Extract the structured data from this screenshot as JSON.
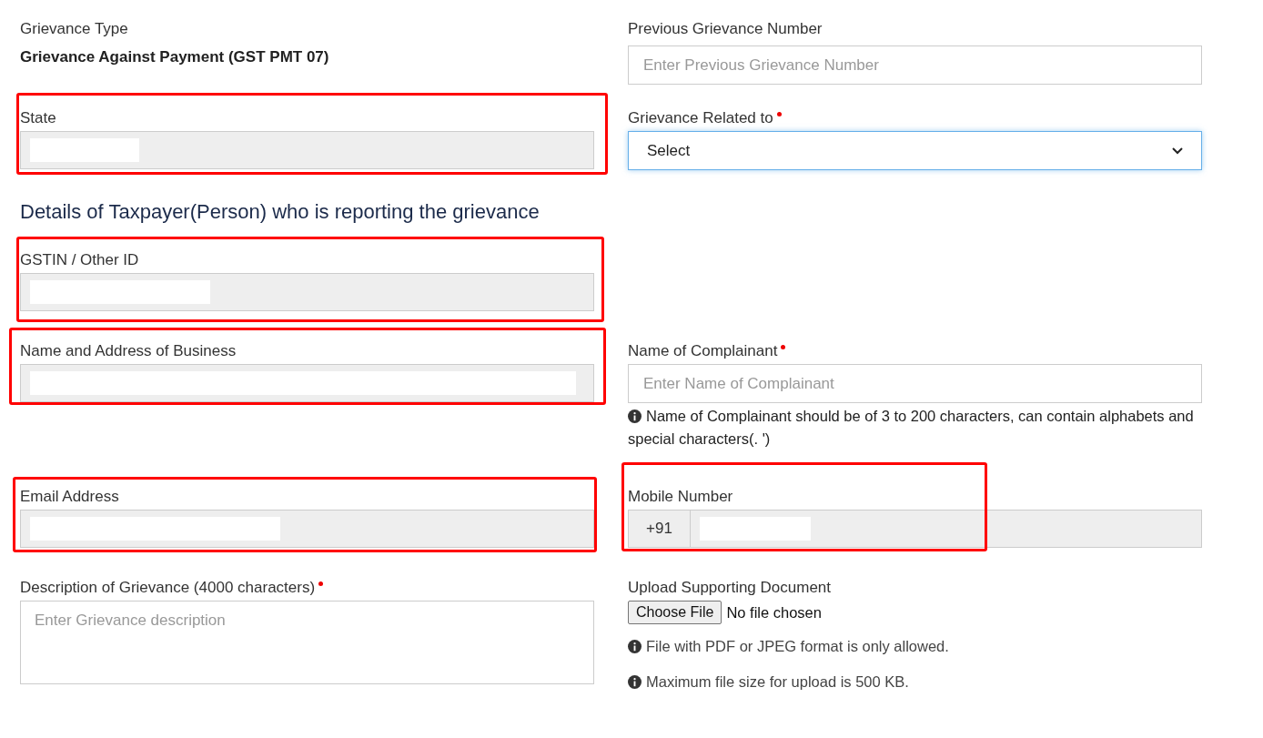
{
  "grievance_type": {
    "label": "Grievance Type",
    "value": "Grievance Against Payment (GST PMT 07)"
  },
  "previous_grievance_number": {
    "label": "Previous Grievance Number",
    "placeholder": "Enter Previous Grievance Number"
  },
  "state": {
    "label": "State",
    "highlighted": true,
    "redacted": true
  },
  "grievance_related_to": {
    "label": "Grievance Related to",
    "required": true,
    "value": "Select",
    "focused": true
  },
  "section_heading": "Details of Taxpayer(Person) who is reporting the grievance",
  "gstin": {
    "label": "GSTIN / Other ID",
    "highlighted": true,
    "redacted": true
  },
  "business": {
    "label": "Name and Address of Business",
    "highlighted": true,
    "redacted": true
  },
  "complainant": {
    "label": "Name of Complainant",
    "required": true,
    "placeholder": "Enter Name of Complainant",
    "hint": "Name of Complainant should be of 3 to 200 characters, can contain alphabets and special characters(. ')"
  },
  "email": {
    "label": "Email Address",
    "highlighted": true,
    "redacted": true
  },
  "mobile": {
    "label": "Mobile Number",
    "prefix": "+91",
    "highlighted": true,
    "redacted": true
  },
  "description": {
    "label": "Description of Grievance (4000 characters)",
    "required": true,
    "placeholder": "Enter Grievance description"
  },
  "upload": {
    "label": "Upload Supporting Document",
    "button": "Choose File",
    "status": "No file chosen",
    "notes": [
      "File with PDF or JPEG format is only allowed.",
      "Maximum file size for upload is 500 KB."
    ]
  }
}
